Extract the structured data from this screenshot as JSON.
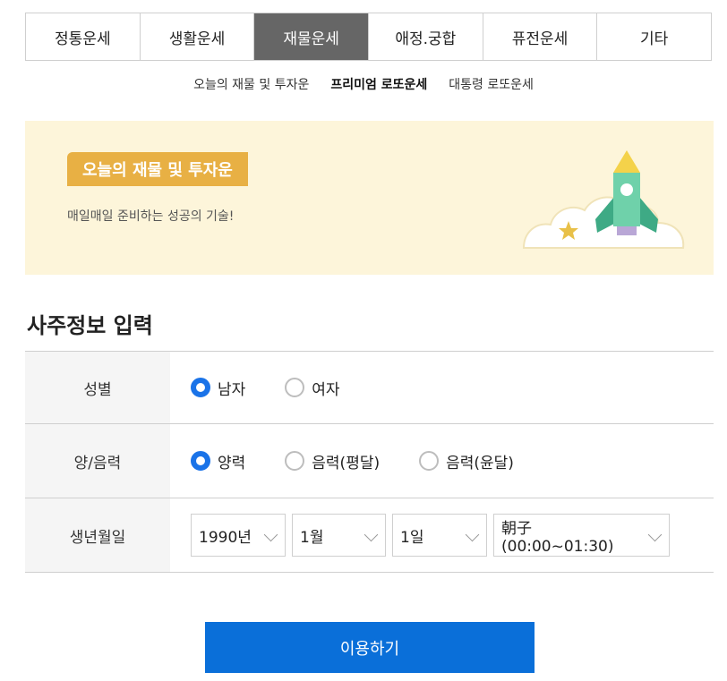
{
  "tabs": [
    {
      "label": "정통운세",
      "active": false
    },
    {
      "label": "생활운세",
      "active": false
    },
    {
      "label": "재물운세",
      "active": true
    },
    {
      "label": "애정.궁합",
      "active": false
    },
    {
      "label": "퓨전운세",
      "active": false
    },
    {
      "label": "기타",
      "active": false
    }
  ],
  "subtabs": [
    {
      "label": "오늘의 재물 및 투자운",
      "active": false
    },
    {
      "label": "프리미엄 로또운세",
      "active": true
    },
    {
      "label": "대통령 로또운세",
      "active": false
    }
  ],
  "banner": {
    "badge": "오늘의 재물 및 투자운",
    "subtitle": "매일매일 준비하는 성공의 기술!"
  },
  "section_title": "사주정보 입력",
  "form": {
    "gender": {
      "label": "성별",
      "options": [
        {
          "label": "남자",
          "checked": true
        },
        {
          "label": "여자",
          "checked": false
        }
      ]
    },
    "calendar": {
      "label": "양/음력",
      "options": [
        {
          "label": "양력",
          "checked": true
        },
        {
          "label": "음력(평달)",
          "checked": false
        },
        {
          "label": "음력(윤달)",
          "checked": false
        }
      ]
    },
    "birth": {
      "label": "생년월일",
      "year": "1990년",
      "month": "1월",
      "day": "1일",
      "hour": "朝子(00:00~01:30)"
    }
  },
  "submit_label": "이용하기",
  "colors": {
    "active_tab": "#666666",
    "banner_bg": "#fdf5da",
    "badge": "#e8b044",
    "radio_checked": "#1a73e8",
    "submit": "#0a6fd9"
  }
}
